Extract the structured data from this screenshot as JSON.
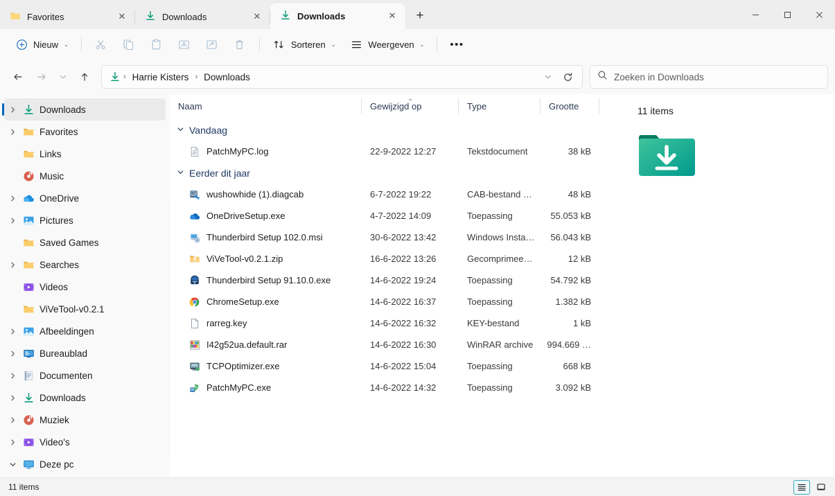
{
  "window": {
    "minimize_label": "–",
    "maximize_label": "□",
    "close_label": "✕"
  },
  "tabs": [
    {
      "label": "Favorites",
      "icon": "folder-icon",
      "active": false,
      "close_label": "✕"
    },
    {
      "label": "Downloads",
      "icon": "downloads-icon",
      "active": false,
      "close_label": "✕"
    },
    {
      "label": "Downloads",
      "icon": "downloads-icon",
      "active": true,
      "close_label": "✕"
    }
  ],
  "newtab_label": "+",
  "toolbar": {
    "new_label": "Nieuw",
    "sort_label": "Sorteren",
    "view_label": "Weergeven",
    "overflow_label": "•••",
    "chevron": "⌄",
    "cut_icon": "scissors-icon",
    "copy_icon": "copy-icon",
    "paste_icon": "paste-icon",
    "rename_icon": "rename-icon",
    "share_icon": "share-icon",
    "delete_icon": "trash-icon"
  },
  "addressbar": {
    "back_label": "←",
    "forward_label": "→",
    "recent_label": "⌄",
    "up_label": "↑",
    "crumb_icon": "downloads-icon",
    "crumbs": [
      "Harrie Kisters",
      "Downloads"
    ],
    "separator": "›",
    "dropdown_label": "⌄",
    "refresh_label": "↻"
  },
  "search": {
    "placeholder": "Zoeken in Downloads",
    "icon": "search-icon"
  },
  "sidebar": {
    "items": [
      {
        "label": "Downloads",
        "icon": "downloads-icon",
        "expandable": true,
        "indent": 0,
        "selected": true
      },
      {
        "label": "Favorites",
        "icon": "folder-icon",
        "expandable": true,
        "indent": 0,
        "selected": false
      },
      {
        "label": "Links",
        "icon": "folder-icon",
        "expandable": false,
        "indent": 0,
        "selected": false
      },
      {
        "label": "Music",
        "icon": "music-icon",
        "expandable": false,
        "indent": 0,
        "selected": false
      },
      {
        "label": "OneDrive",
        "icon": "cloud-icon",
        "expandable": true,
        "indent": 0,
        "selected": false
      },
      {
        "label": "Pictures",
        "icon": "pictures-icon",
        "expandable": true,
        "indent": 0,
        "selected": false
      },
      {
        "label": "Saved Games",
        "icon": "folder-icon",
        "expandable": false,
        "indent": 0,
        "selected": false
      },
      {
        "label": "Searches",
        "icon": "folder-icon",
        "expandable": true,
        "indent": 0,
        "selected": false
      },
      {
        "label": "Videos",
        "icon": "videos-icon",
        "expandable": false,
        "indent": 0,
        "selected": false
      },
      {
        "label": "ViVeTool-v0.2.1",
        "icon": "folder-icon",
        "expandable": false,
        "indent": 0,
        "selected": false
      },
      {
        "label": "Afbeeldingen",
        "icon": "pictures-icon",
        "expandable": true,
        "indent": 0,
        "selected": false
      },
      {
        "label": "Bureaublad",
        "icon": "desktop-icon",
        "expandable": true,
        "indent": 0,
        "selected": false
      },
      {
        "label": "Documenten",
        "icon": "documents-icon",
        "expandable": true,
        "indent": 0,
        "selected": false
      },
      {
        "label": "Downloads",
        "icon": "downloads-icon",
        "expandable": true,
        "indent": 0,
        "selected": false
      },
      {
        "label": "Muziek",
        "icon": "music-icon",
        "expandable": true,
        "indent": 0,
        "selected": false
      },
      {
        "label": "Video's",
        "icon": "videos-icon",
        "expandable": true,
        "indent": 0,
        "selected": false
      },
      {
        "label": "Deze pc",
        "icon": "monitor-icon",
        "expandable": true,
        "expanded": true,
        "indent": 0,
        "selected": false
      }
    ]
  },
  "columns": [
    {
      "key": "name",
      "label": "Naam",
      "sorted": false
    },
    {
      "key": "date",
      "label": "Gewijzigd op",
      "sorted": true,
      "sort_glyph": "⌄"
    },
    {
      "key": "type",
      "label": "Type",
      "sorted": false
    },
    {
      "key": "size",
      "label": "Grootte",
      "sorted": false
    }
  ],
  "groups": [
    {
      "label": "Vandaag",
      "chevron": "⌄",
      "rows": [
        {
          "name": "PatchMyPC.log",
          "date": "22-9-2022 12:27",
          "type": "Tekstdocument",
          "size": "38 kB",
          "icon": "text-file-icon"
        }
      ]
    },
    {
      "label": "Eerder dit jaar",
      "chevron": "⌄",
      "rows": [
        {
          "name": "wushowhide (1).diagcab",
          "date": "6-7-2022 19:22",
          "type": "CAB-bestand …",
          "size": "48 kB",
          "icon": "diagcab-icon"
        },
        {
          "name": "OneDriveSetup.exe",
          "date": "4-7-2022 14:09",
          "type": "Toepassing",
          "size": "55.053 kB",
          "icon": "onedrive-icon"
        },
        {
          "name": "Thunderbird Setup 102.0.msi",
          "date": "30-6-2022 13:42",
          "type": "Windows Insta…",
          "size": "56.043 kB",
          "icon": "msi-icon"
        },
        {
          "name": "ViVeTool-v0.2.1.zip",
          "date": "16-6-2022 13:26",
          "type": "Gecomprimee…",
          "size": "12 kB",
          "icon": "zip-icon"
        },
        {
          "name": "Thunderbird Setup 91.10.0.exe",
          "date": "14-6-2022 19:24",
          "type": "Toepassing",
          "size": "54.792 kB",
          "icon": "thunderbird-icon"
        },
        {
          "name": "ChromeSetup.exe",
          "date": "14-6-2022 16:37",
          "type": "Toepassing",
          "size": "1.382 kB",
          "icon": "chrome-icon"
        },
        {
          "name": "rarreg.key",
          "date": "14-6-2022 16:32",
          "type": "KEY-bestand",
          "size": "1 kB",
          "icon": "blank-file-icon"
        },
        {
          "name": "I42g52ua.default.rar",
          "date": "14-6-2022 16:30",
          "type": "WinRAR archive",
          "size": "994.669 …",
          "icon": "rar-icon"
        },
        {
          "name": "TCPOptimizer.exe",
          "date": "14-6-2022 15:04",
          "type": "Toepassing",
          "size": "668 kB",
          "icon": "tcpopt-icon"
        },
        {
          "name": "PatchMyPC.exe",
          "date": "14-6-2022 14:32",
          "type": "Toepassing",
          "size": "3.092 kB",
          "icon": "patchmypc-icon"
        }
      ]
    }
  ],
  "details": {
    "count_label": "11 items",
    "thumb_icon": "downloads-folder-large-icon"
  },
  "statusbar": {
    "items_label": "11 items",
    "details_view_icon": "details-view-icon",
    "large_icons_view_icon": "large-icons-view-icon"
  },
  "colors": {
    "accent": "#0067c0",
    "group_header": "#1f3864",
    "downloads_green": "#0f9d7a",
    "folder_yellow": "#f6c761"
  }
}
